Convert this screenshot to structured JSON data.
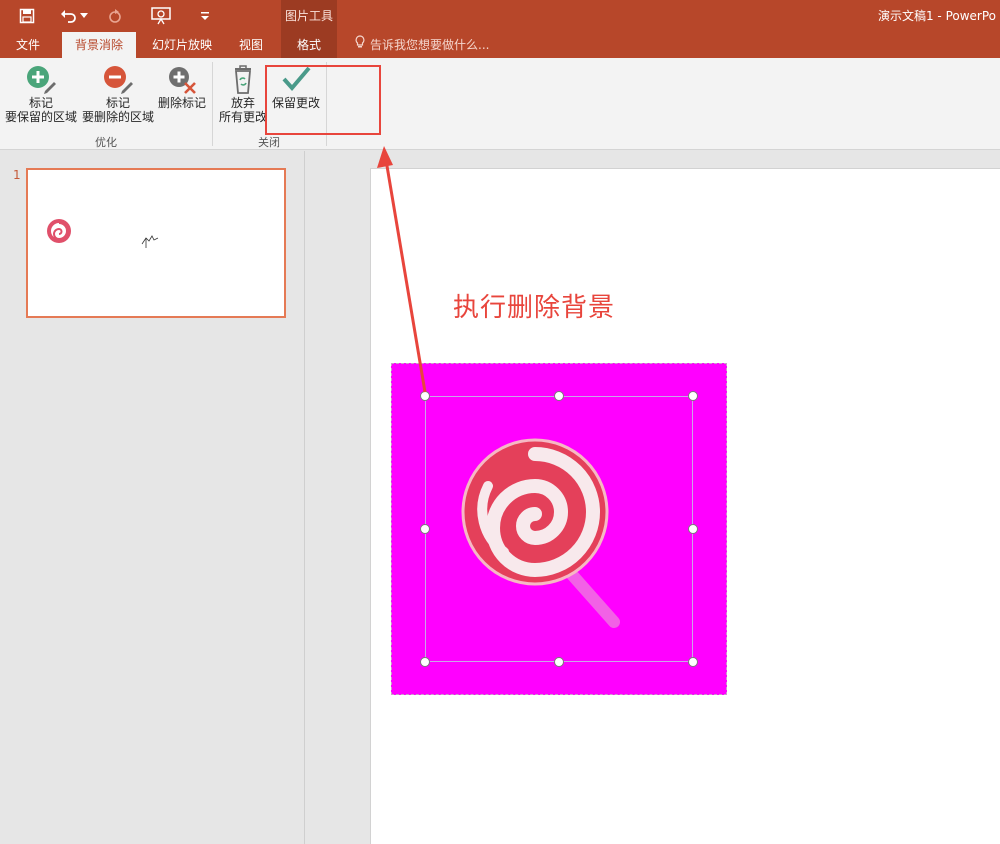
{
  "titlebar": {
    "context_header": "图片工具",
    "window_title": "演示文稿1 - PowerPo"
  },
  "tabs": {
    "file": "文件",
    "background_removal": "背景消除",
    "slideshow": "幻灯片放映",
    "view": "视图",
    "format": "格式",
    "tell_me": "告诉我您想要做什么..."
  },
  "ribbon": {
    "mark_keep_line1": "标记",
    "mark_keep_line2": "要保留的区域",
    "mark_remove_line1": "标记",
    "mark_remove_line2": "要删除的区域",
    "delete_mark": "删除标记",
    "discard_line1": "放弃",
    "discard_line2": "所有更改",
    "keep_changes": "保留更改",
    "group_refine": "优化",
    "group_close": "关闭"
  },
  "thumbnails": {
    "slide_number": "1"
  },
  "slide": {
    "text": "执行删除背景"
  },
  "colors": {
    "accent": "#b7472a",
    "picture_background": "#ff00ff",
    "annotation_red": "#e8453c"
  }
}
